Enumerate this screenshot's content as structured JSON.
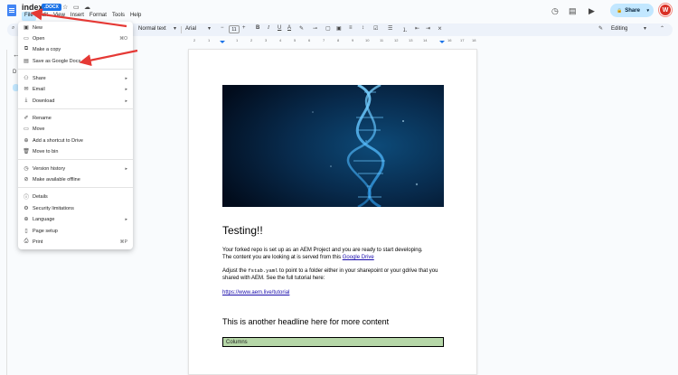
{
  "header": {
    "doc_title": "index",
    "ext_badge": ".DOCX",
    "share_label": "Share",
    "avatar_initial": "W"
  },
  "menubar": [
    "File",
    "Edit",
    "View",
    "Insert",
    "Format",
    "Tools",
    "Help"
  ],
  "toolbar": {
    "style": "Normal text",
    "font": "Arial",
    "size": "11",
    "mode": "Editing"
  },
  "ruler": [
    "2",
    "1",
    "1",
    "2",
    "3",
    "4",
    "5",
    "6",
    "7",
    "8",
    "9",
    "10",
    "11",
    "12",
    "13",
    "14",
    "15",
    "16",
    "17",
    "18",
    "19"
  ],
  "sidebar": {
    "letter": "D"
  },
  "file_menu": {
    "new": "New",
    "open": "Open",
    "open_shortcut": "⌘O",
    "make_copy": "Make a copy",
    "save_as_docs": "Save as Google Docs",
    "share": "Share",
    "email": "Email",
    "download": "Download",
    "rename": "Rename",
    "move": "Move",
    "add_shortcut": "Add a shortcut to Drive",
    "move_to_bin": "Move to bin",
    "version_history": "Version history",
    "offline": "Make available offline",
    "details": "Details",
    "security": "Security limitations",
    "language": "Language",
    "page_setup": "Page setup",
    "print": "Print",
    "print_shortcut": "⌘P"
  },
  "document": {
    "heading1": "Testing!!",
    "p1_line1": "Your forked repo is set up as an AEM Project and you are ready to start developing.",
    "p1_line2_pre": "The content you are looking at is served from this ",
    "p1_link": "Google Drive",
    "p2_pre": "Adjust the ",
    "p2_code": "fstab.yaml",
    "p2_post": " to point to a folder either in your sharepoint or your gdrive that you",
    "p2_line2": "shared with AEM. See the full tutorial here:",
    "tutorial_link": "https://www.aem.live/tutorial",
    "heading2": "This is another headline here for more content",
    "columns_label": "Columns"
  },
  "colors": {
    "accent": "#1a73e8",
    "share_bg": "#c2e7ff",
    "annotation": "#e53935",
    "columns_bg": "#b6d7a8"
  }
}
